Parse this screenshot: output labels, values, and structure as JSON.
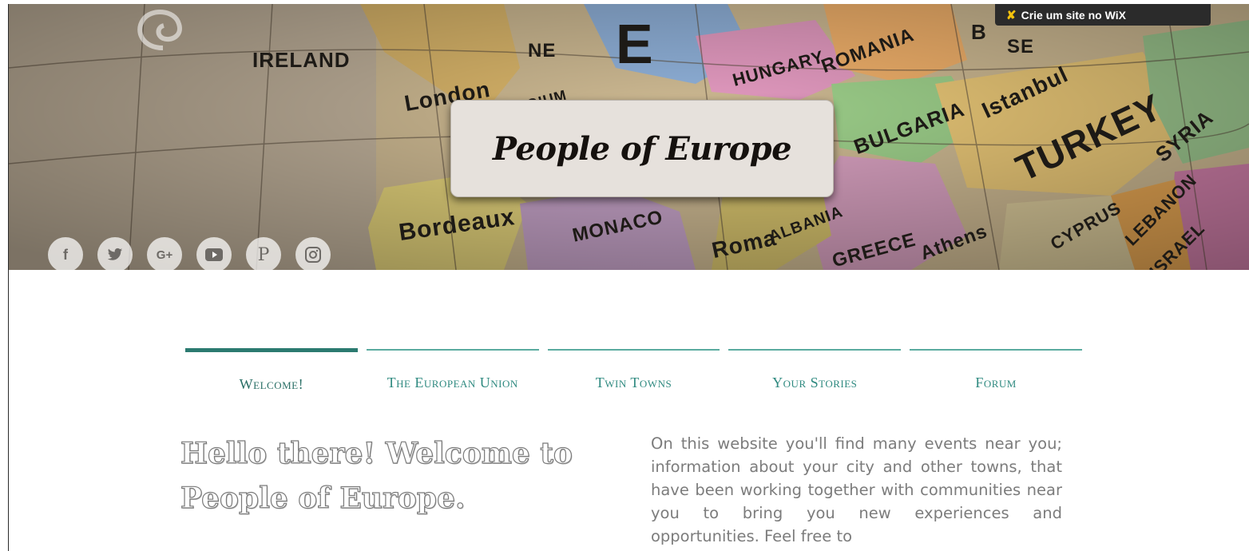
{
  "header": {
    "site_title": "People of Europe",
    "wix_banner": "Crie um site no WiX",
    "map_labels": [
      "IRELAND",
      "London",
      "BELGIUM",
      "E",
      "HUNGARY",
      "ROMANIA",
      "BULGARIA",
      "Istanbul",
      "TURKEY",
      "SYRIA",
      "Bordeaux",
      "MONACO",
      "Roma",
      "ALBANIA",
      "GREECE",
      "Athens",
      "CYPRUS",
      "LEBANON",
      "ISRAEL",
      "B",
      "SE",
      "NE"
    ]
  },
  "social": [
    {
      "name": "facebook-icon",
      "glyph": "f"
    },
    {
      "name": "twitter-icon",
      "glyph": "🐦"
    },
    {
      "name": "google-plus-icon",
      "glyph": "G+"
    },
    {
      "name": "youtube-icon",
      "glyph": "▶"
    },
    {
      "name": "pinterest-icon",
      "glyph": "P"
    },
    {
      "name": "instagram-icon",
      "glyph": "◎"
    }
  ],
  "nav": {
    "items": [
      {
        "label": "Welcome!",
        "active": true
      },
      {
        "label": "The European Union",
        "active": false
      },
      {
        "label": "Twin Towns",
        "active": false
      },
      {
        "label": "Your Stories",
        "active": false
      },
      {
        "label": "Forum",
        "active": false
      }
    ]
  },
  "main": {
    "heading": "Hello there! Welcome to People of Europe.",
    "intro": "On this website you'll find many events near you; information about your city and other towns, that have been working together with communities near you to bring you new experiences and opportunities. Feel free to"
  },
  "colors": {
    "accent": "#2b7a70",
    "nav_text": "#2f8a80",
    "title_box": "#e6e1dc",
    "wix_bar": "#2b2b2b"
  }
}
